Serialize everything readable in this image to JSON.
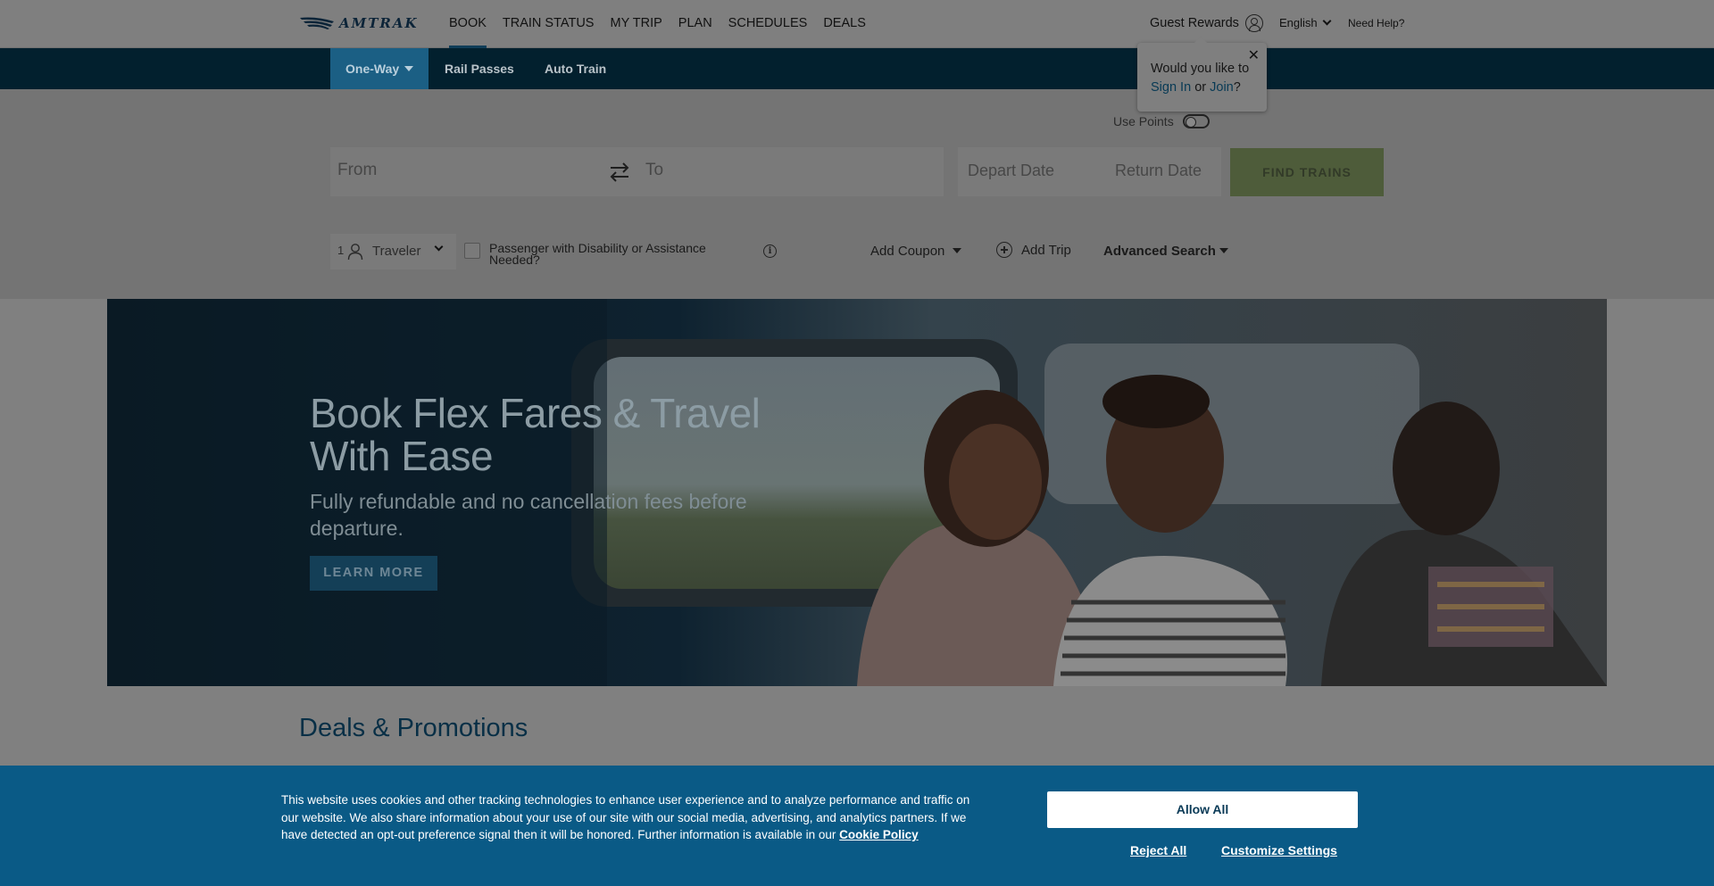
{
  "brand": {
    "logo_text": "AMTRAK"
  },
  "nav": {
    "items": [
      {
        "label": "BOOK",
        "active": true
      },
      {
        "label": "TRAIN STATUS",
        "active": false
      },
      {
        "label": "MY TRIP",
        "active": false
      },
      {
        "label": "PLAN",
        "active": false
      },
      {
        "label": "SCHEDULES",
        "active": false
      },
      {
        "label": "DEALS",
        "active": false
      }
    ],
    "guest_rewards": "Guest Rewards",
    "language": "English",
    "need_help": "Need Help?"
  },
  "popover": {
    "line1": "Would you like to",
    "sign_in": "Sign In",
    "or": "or",
    "join": "Join",
    "qmark": "?"
  },
  "booking": {
    "tabs": {
      "one_way": "One-Way",
      "rail_passes": "Rail Passes",
      "auto_train": "Auto Train"
    },
    "use_points": "Use Points",
    "from_placeholder": "From",
    "to_placeholder": "To",
    "depart_placeholder": "Depart Date",
    "return_placeholder": "Return Date",
    "find_trains": "FIND TRAINS",
    "traveler_count": "1",
    "traveler_label": "Traveler",
    "disability_label": "Passenger with Disability or Assistance Needed?",
    "info": "i",
    "add_coupon": "Add Coupon",
    "add_trip": "Add Trip",
    "advanced_search": "Advanced Search"
  },
  "hero": {
    "title": "Book Flex Fares & Travel With Ease",
    "subtitle": "Fully refundable and no cancellation fees before departure.",
    "cta": "LEARN MORE"
  },
  "deals": {
    "title": "Deals & Promotions"
  },
  "cookie": {
    "text": "This website uses cookies and other tracking technologies to enhance user experience and to analyze performance and traffic on our website. We also share information about your use of our site with our social media, advertising, and analytics partners. If we have detected an opt-out preference signal then it will be honored. Further information is available in our",
    "policy_link": "Cookie Policy",
    "allow_all": "Allow All",
    "reject_all": "Reject All",
    "customize": "Customize Settings"
  },
  "colors": {
    "nav_dark": "#02202e",
    "active_tab": "#1b5f84",
    "find_button": "#4e5c3a",
    "cookie_bg": "#0a5a86",
    "deals_title": "#082f46"
  }
}
